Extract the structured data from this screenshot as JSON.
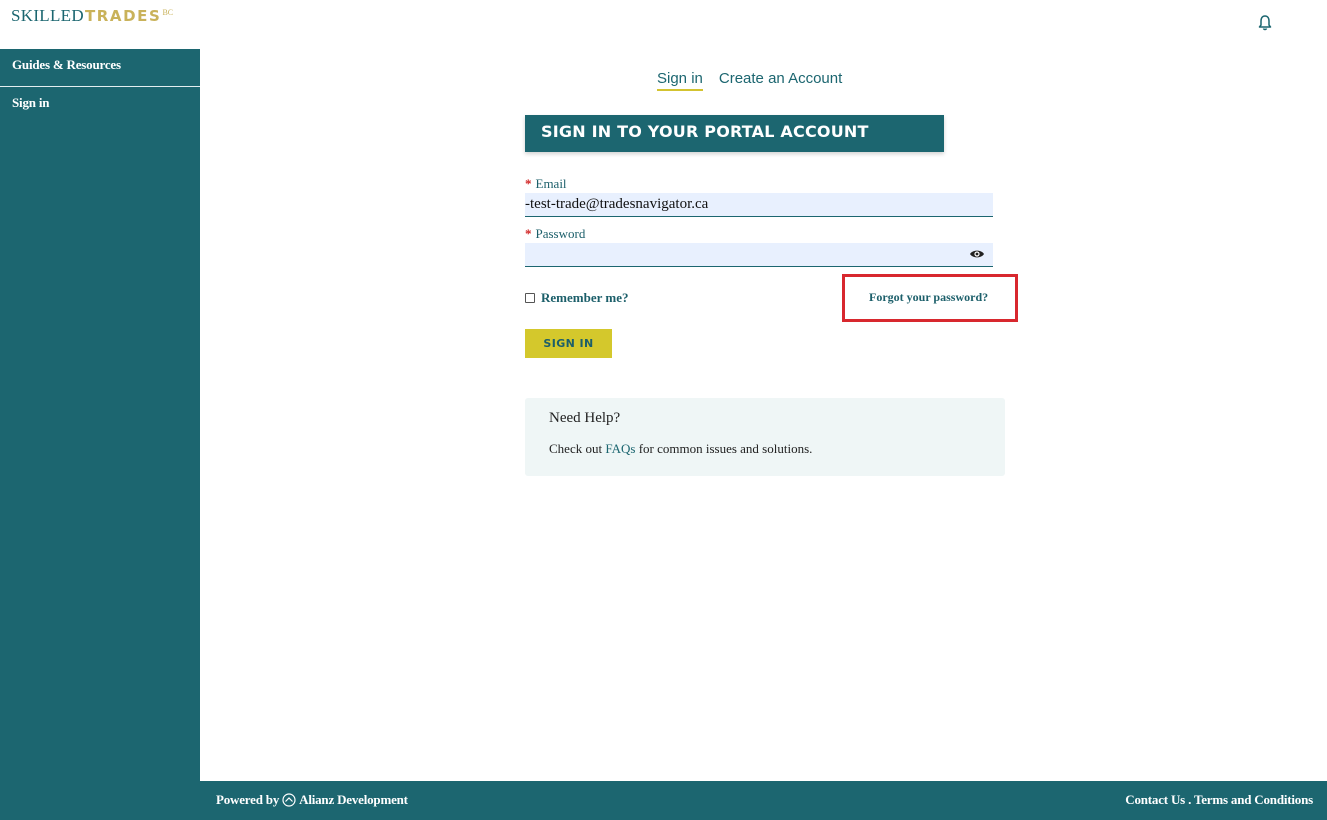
{
  "brand": {
    "part1": "SKILLED",
    "part2": "TRADES",
    "part3": "BC"
  },
  "header": {
    "bell_icon": "bell-icon"
  },
  "sidebar": {
    "items": [
      {
        "label": "Guides & Resources"
      },
      {
        "label": "Sign in"
      }
    ]
  },
  "tabs": [
    {
      "label": "Sign in",
      "active": true
    },
    {
      "label": "Create an Account",
      "active": false
    }
  ],
  "form": {
    "heading": "SIGN IN TO YOUR PORTAL ACCOUNT",
    "required_mark": "*",
    "email_label": "Email",
    "email_value": "-test-trade@tradesnavigator.ca",
    "password_label": "Password",
    "password_value": "",
    "show_password_icon": "eye-icon",
    "remember_label": "Remember me?",
    "forgot_label": "Forgot your password?",
    "submit_label": "SIGN IN"
  },
  "help": {
    "title": "Need Help?",
    "text_before": "Check out ",
    "link": "FAQs",
    "text_after": " for common issues and solutions."
  },
  "footer": {
    "powered_prefix": "Powered by",
    "company": "Alianz Development",
    "contact": "Contact Us",
    "separator": " . ",
    "terms": "Terms and Conditions"
  },
  "colors": {
    "primary": "#1c6670",
    "accent": "#d4c82c",
    "logo_gold": "#c9b25a",
    "highlight": "#d8282e"
  }
}
